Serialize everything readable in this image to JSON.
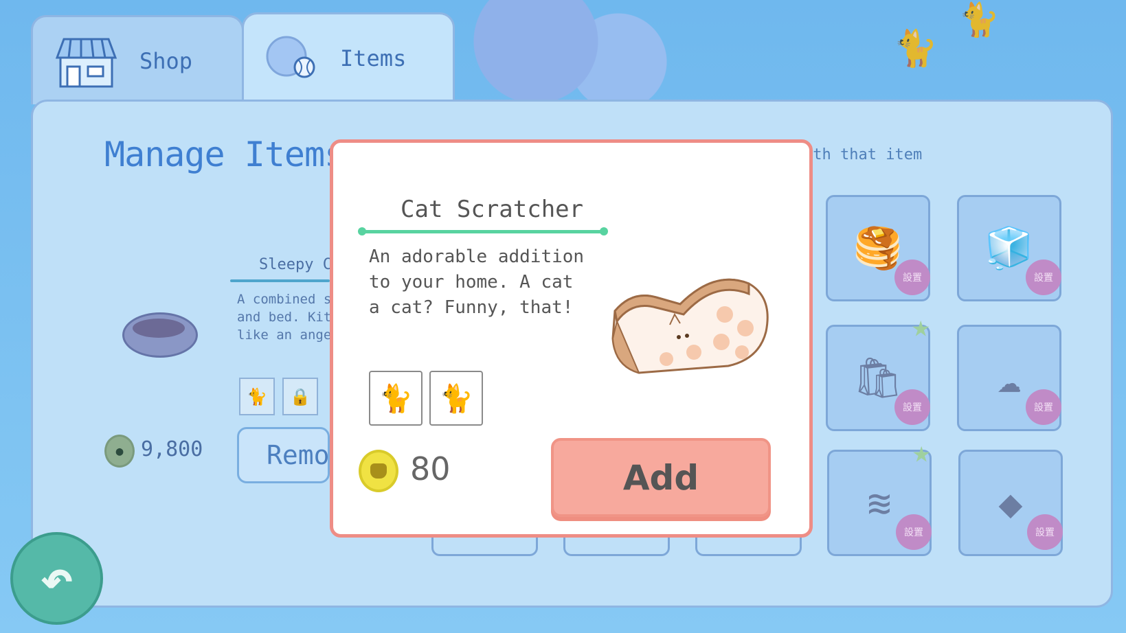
{
  "tabs": {
    "shop_label": "Shop",
    "items_label": "Items"
  },
  "panel": {
    "title": "Manage Items",
    "hint_fragment": "ith that item",
    "selected_item": {
      "name_fragment": "Sleepy C",
      "desc_fragment": "A combined s\nand bed. Kit\nlike an ange",
      "price": "9,800",
      "remove_fragment": "Remo"
    },
    "slot_badge": "設置"
  },
  "dialog": {
    "item_name": "Cat Scratcher",
    "description": "An adorable addition\nto your home. A cat\na cat? Funny, that!",
    "price": "80",
    "add_label": "Add"
  },
  "icons": {
    "shop": "shop-icon",
    "items": "ball-icon",
    "back": "back-arrow-icon",
    "coin": "cat-coin-icon"
  },
  "colors": {
    "dialog_border": "#ee8d86",
    "add_button": "#f7a99d",
    "name_underline": "#58d3a0",
    "title": "#3f7fd1"
  }
}
